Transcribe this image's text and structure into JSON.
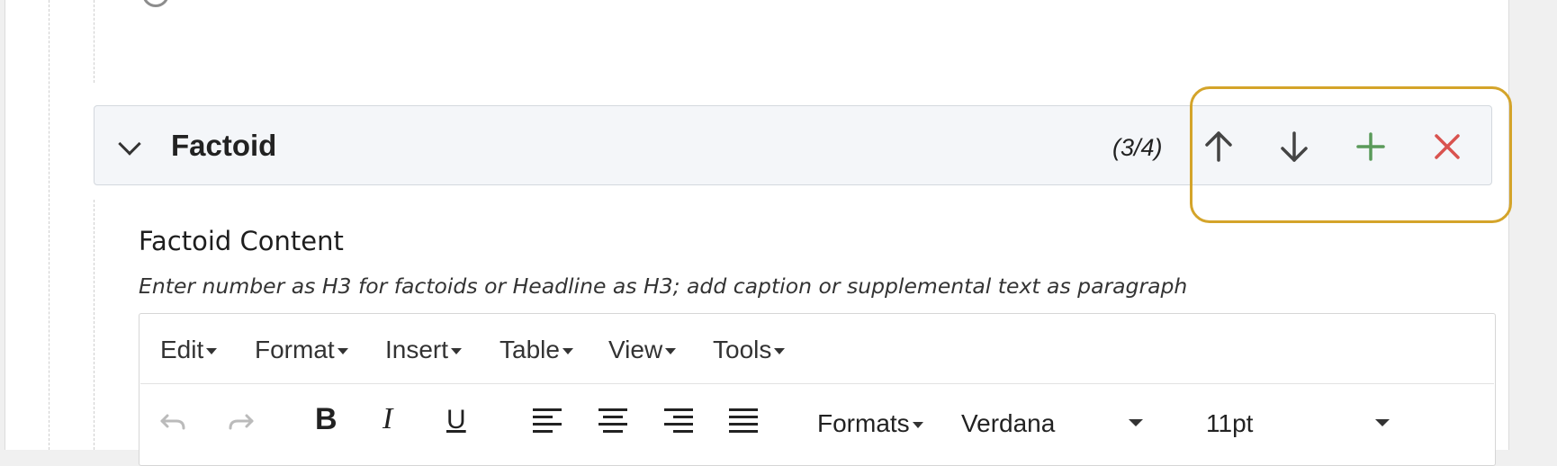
{
  "section": {
    "title": "Factoid",
    "counter": "(3/4)",
    "actions": [
      {
        "name": "move-up",
        "icon": "arrow-up-icon",
        "color": "#444444"
      },
      {
        "name": "move-down",
        "icon": "arrow-down-icon",
        "color": "#444444"
      },
      {
        "name": "add",
        "icon": "plus-icon",
        "color": "#5a9a5a"
      },
      {
        "name": "remove",
        "icon": "close-icon",
        "color": "#d9534f"
      }
    ],
    "highlight_color": "#d4a42a"
  },
  "field": {
    "label": "Factoid Content",
    "help": "Enter number as H3 for factoids or Headline as H3; add caption or supplemental text as paragraph"
  },
  "editor": {
    "menu": [
      "Edit",
      "Format",
      "Insert",
      "Table",
      "View",
      "Tools"
    ],
    "toolbar": {
      "undo_icon": "undo-icon",
      "redo_icon": "redo-icon",
      "bold": "B",
      "italic": "I",
      "underline": "U",
      "align_icons": [
        "align-left-icon",
        "align-center-icon",
        "align-right-icon",
        "align-justify-icon"
      ],
      "formats_label": "Formats",
      "font_family": "Verdana",
      "font_size": "11pt"
    }
  }
}
